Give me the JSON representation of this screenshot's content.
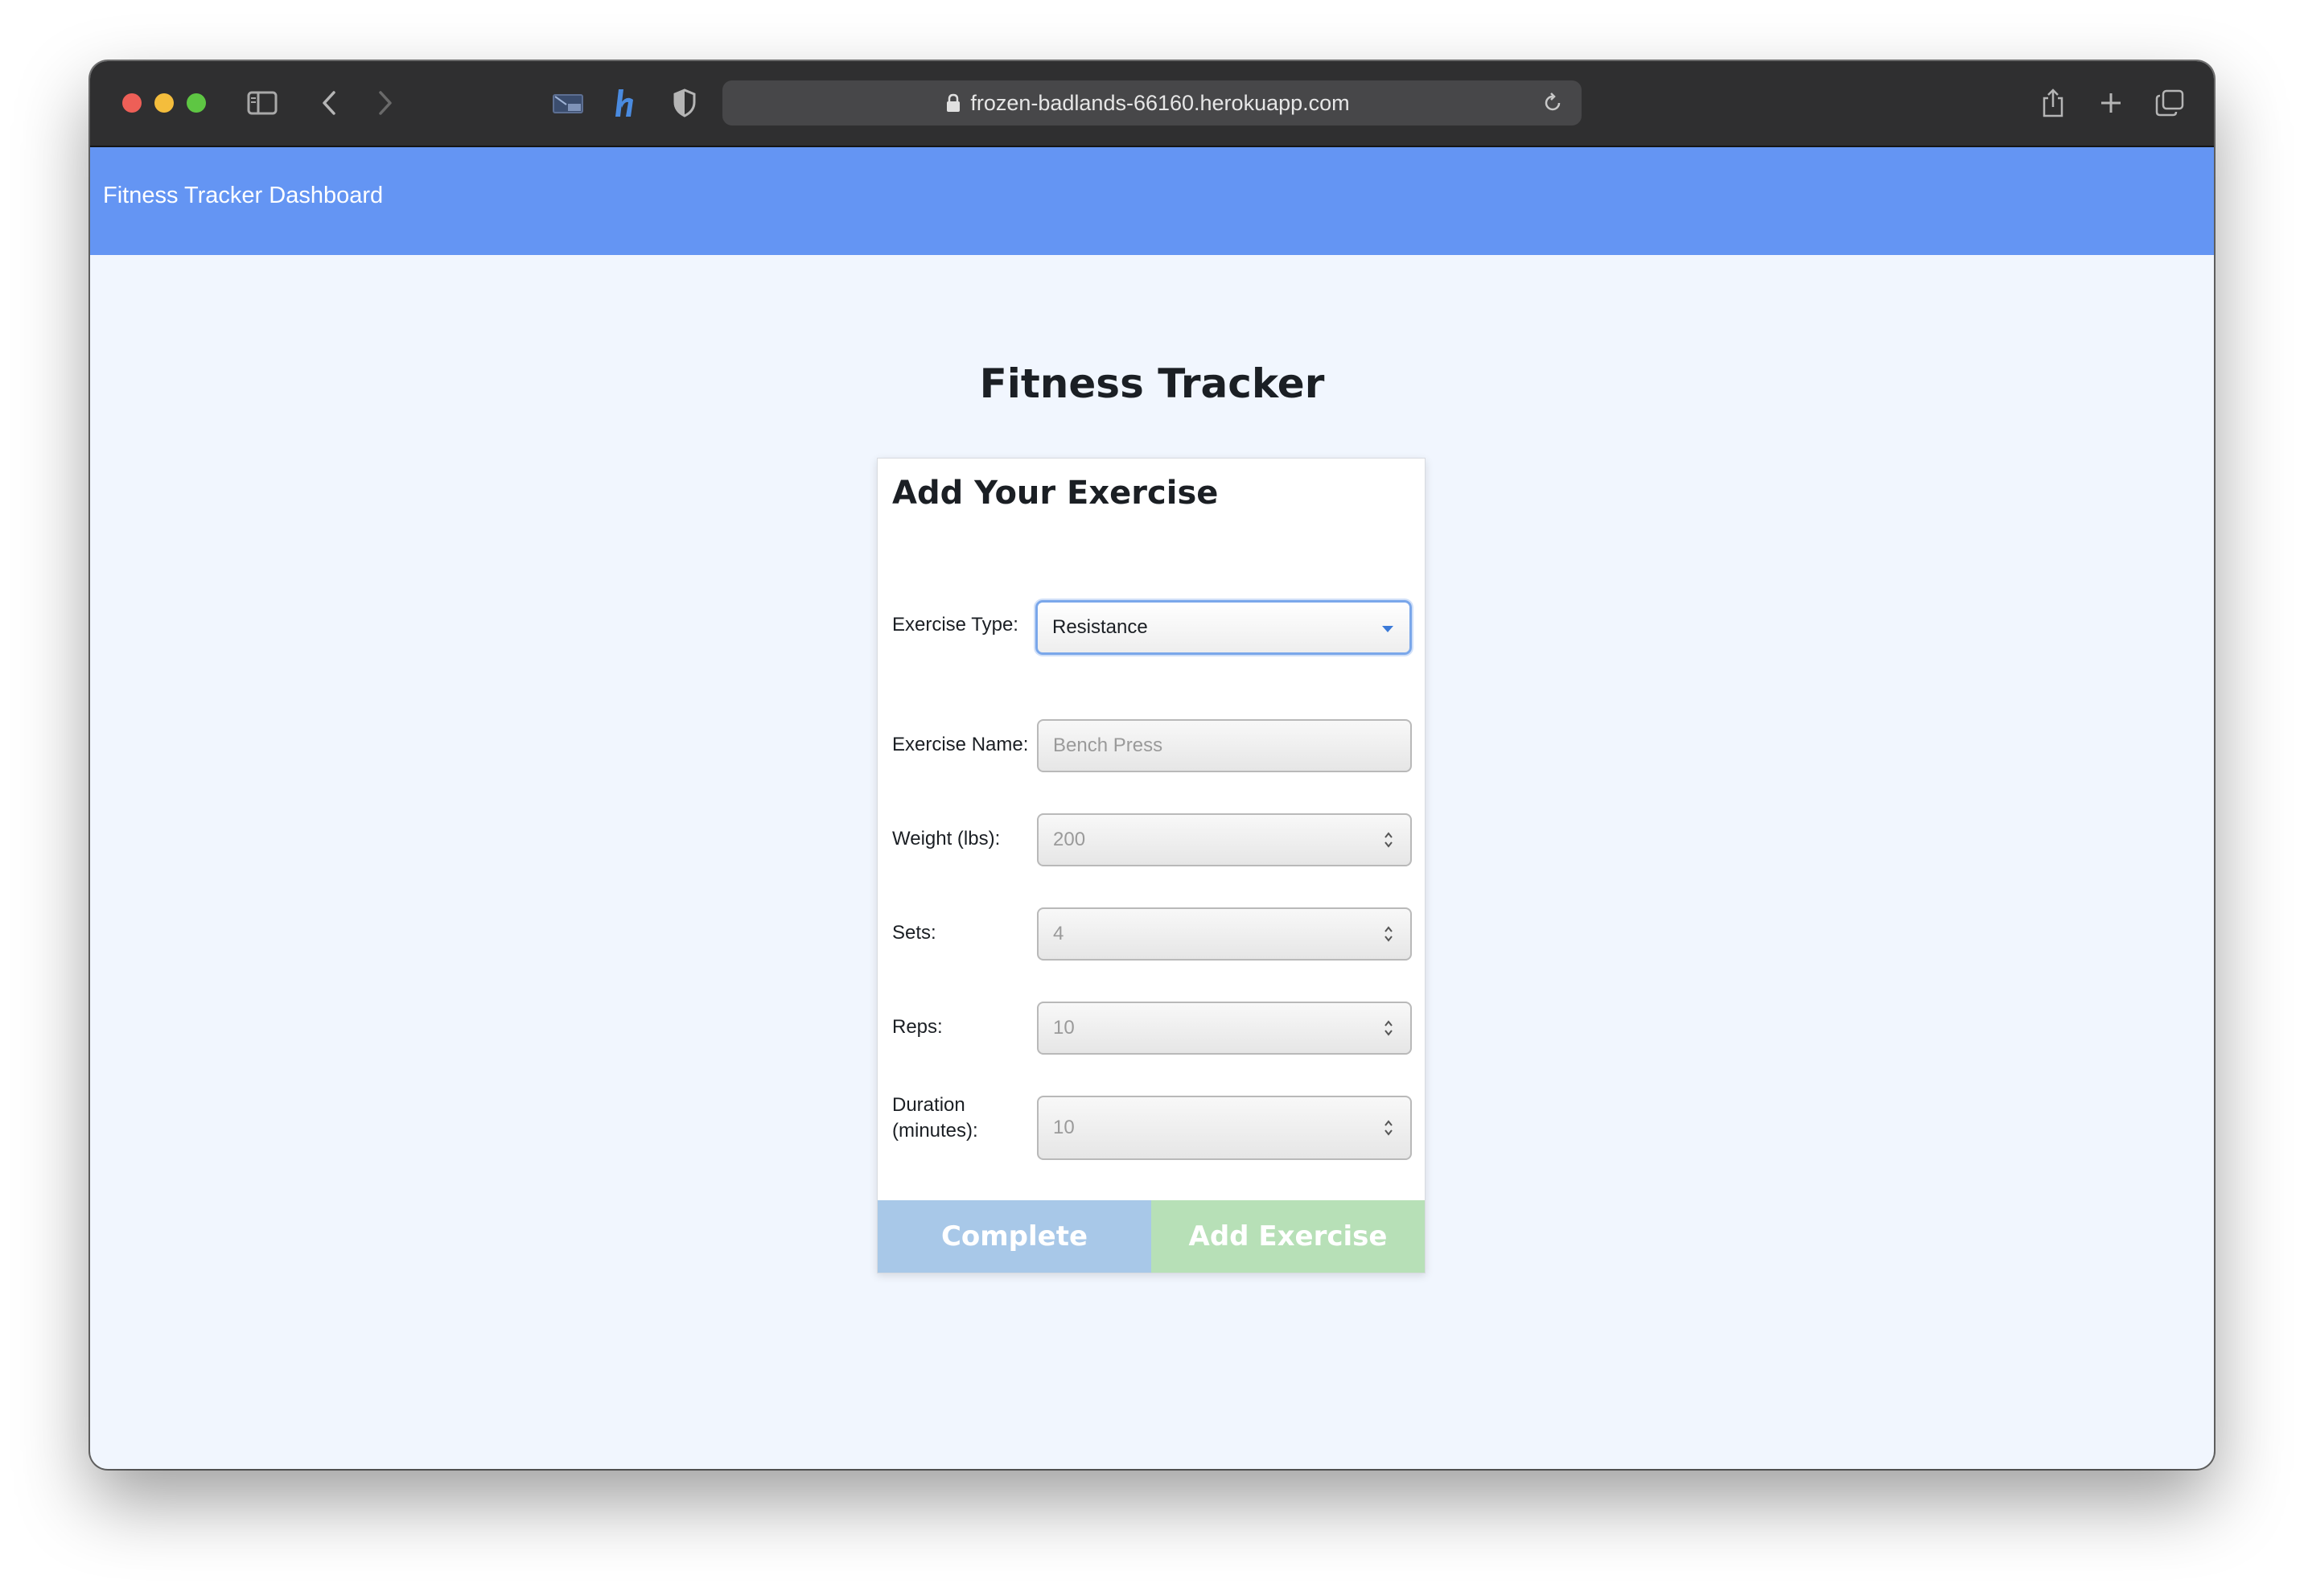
{
  "browser": {
    "url": "frozen-badlands-66160.herokuapp.com"
  },
  "navbar": {
    "brand": "Fitness Tracker Dashboard"
  },
  "page": {
    "title": "Fitness Tracker"
  },
  "form": {
    "title": "Add Your Exercise",
    "exercise_type": {
      "label": "Exercise Type:",
      "selected": "Resistance"
    },
    "exercise_name": {
      "label": "Exercise Name:",
      "placeholder": "Bench Press"
    },
    "weight": {
      "label": "Weight (lbs):",
      "placeholder": "200"
    },
    "sets": {
      "label": "Sets:",
      "placeholder": "4"
    },
    "reps": {
      "label": "Reps:",
      "placeholder": "10"
    },
    "duration": {
      "label_line1": "Duration",
      "label_line2": "(minutes):",
      "placeholder": "10"
    },
    "complete_button": "Complete",
    "add_button": "Add Exercise"
  },
  "colors": {
    "navbar": "#6495f3",
    "page_background": "#f1f6fe",
    "complete_button": "#a8c8e8",
    "add_button": "#b7e0b7"
  }
}
